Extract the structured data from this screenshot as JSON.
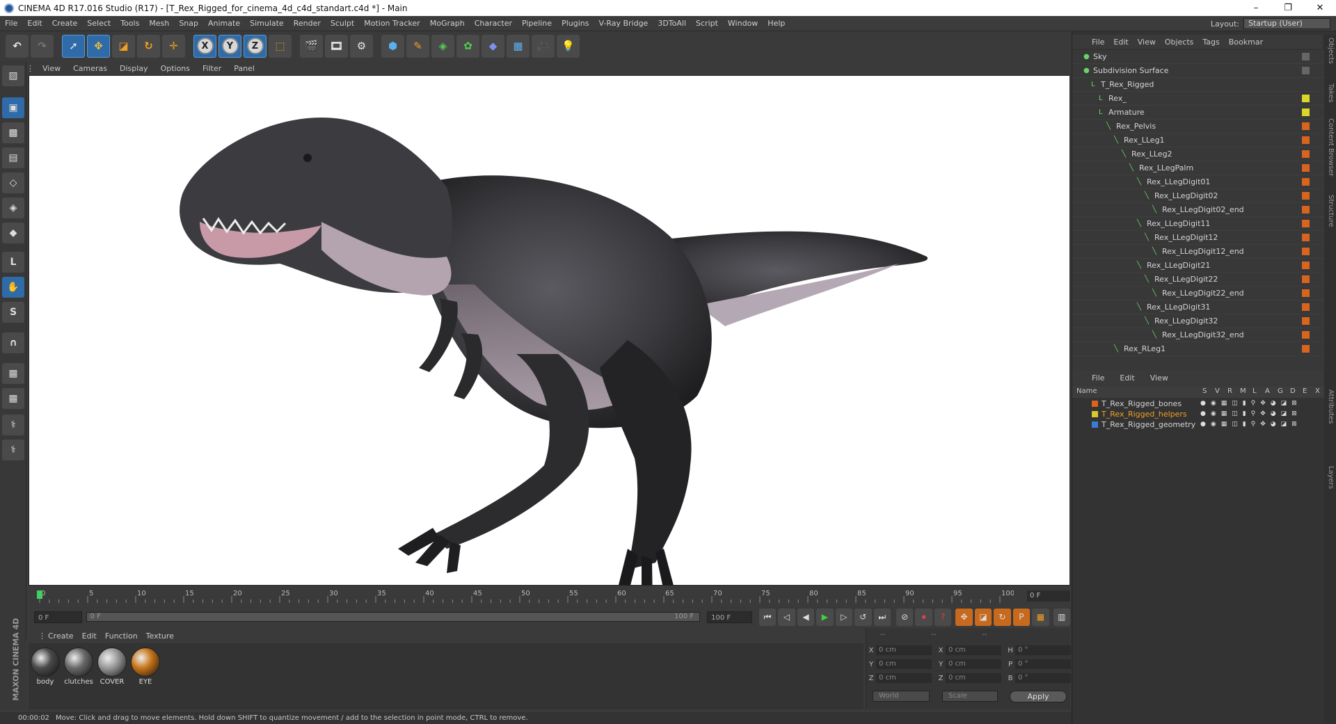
{
  "window": {
    "title": "CINEMA 4D R17.016 Studio (R17) - [T_Rex_Rigged_for_cinema_4d_c4d_standart.c4d *] - Main"
  },
  "menubar": [
    "File",
    "Edit",
    "Create",
    "Select",
    "Tools",
    "Mesh",
    "Snap",
    "Animate",
    "Simulate",
    "Render",
    "Sculpt",
    "Motion Tracker",
    "MoGraph",
    "Character",
    "Pipeline",
    "Plugins",
    "V-Ray Bridge",
    "3DToAll",
    "Script",
    "Window",
    "Help"
  ],
  "layout": {
    "label": "Layout:",
    "value": "Startup (User)"
  },
  "viewport": {
    "menu": [
      "View",
      "Cameras",
      "Display",
      "Options",
      "Filter",
      "Panel"
    ]
  },
  "timeline": {
    "ticks": [
      "0",
      "5",
      "10",
      "15",
      "20",
      "25",
      "30",
      "35",
      "40",
      "45",
      "50",
      "55",
      "60",
      "65",
      "70",
      "75",
      "80",
      "85",
      "90",
      "95",
      "100"
    ],
    "current_frame": "0 F",
    "start_field": "0 F",
    "slider_start": "0 F",
    "slider_end": "100 F",
    "end_field": "100 F"
  },
  "materials": {
    "menu": [
      "Create",
      "Edit",
      "Function",
      "Texture"
    ],
    "items": [
      {
        "name": "body",
        "color": "#4a4a4a"
      },
      {
        "name": "clutches",
        "color": "#6a6a6a"
      },
      {
        "name": "COVER",
        "color": "#9a9a9a"
      },
      {
        "name": "EYE",
        "color": "#c8761a"
      }
    ]
  },
  "coords": {
    "headers": [
      "--",
      "--",
      "--"
    ],
    "rows": [
      {
        "a1": "X",
        "v1": "0 cm",
        "a2": "X",
        "v2": "0 cm",
        "a3": "H",
        "v3": "0 °"
      },
      {
        "a1": "Y",
        "v1": "0 cm",
        "a2": "Y",
        "v2": "0 cm",
        "a3": "P",
        "v3": "0 °"
      },
      {
        "a1": "Z",
        "v1": "0 cm",
        "a2": "Z",
        "v2": "0 cm",
        "a3": "B",
        "v3": "0 °"
      }
    ],
    "world": "World",
    "scale": "Scale",
    "apply": "Apply"
  },
  "status": {
    "time": "00:00:02",
    "message": "Move: Click and drag to move elements. Hold down SHIFT to quantize movement / add to the selection in point mode, CTRL to remove."
  },
  "brand": "MAXON CINEMA 4D",
  "objects": {
    "menu": [
      "File",
      "Edit",
      "View",
      "Objects",
      "Tags",
      "Bookmar"
    ],
    "items": [
      {
        "name": "Sky",
        "depth": 0,
        "tag": "#666666"
      },
      {
        "name": "Subdivision Surface",
        "depth": 0,
        "tag": "#666666"
      },
      {
        "name": "T_Rex_Rigged",
        "depth": 1,
        "tag": ""
      },
      {
        "name": "Rex_",
        "depth": 2,
        "tag": "#d8d82a"
      },
      {
        "name": "Armature",
        "depth": 2,
        "tag": "#d8d82a"
      },
      {
        "name": "Rex_Pelvis",
        "depth": 3,
        "tag": "#d8641e"
      },
      {
        "name": "Rex_LLeg1",
        "depth": 4,
        "tag": "#d8641e"
      },
      {
        "name": "Rex_LLeg2",
        "depth": 5,
        "tag": "#d8641e"
      },
      {
        "name": "Rex_LLegPalm",
        "depth": 6,
        "tag": "#d8641e"
      },
      {
        "name": "Rex_LLegDigit01",
        "depth": 7,
        "tag": "#d8641e"
      },
      {
        "name": "Rex_LLegDigit02",
        "depth": 8,
        "tag": "#d8641e"
      },
      {
        "name": "Rex_LLegDigit02_end",
        "depth": 9,
        "tag": "#d8641e"
      },
      {
        "name": "Rex_LLegDigit11",
        "depth": 7,
        "tag": "#d8641e"
      },
      {
        "name": "Rex_LLegDigit12",
        "depth": 8,
        "tag": "#d8641e"
      },
      {
        "name": "Rex_LLegDigit12_end",
        "depth": 9,
        "tag": "#d8641e"
      },
      {
        "name": "Rex_LLegDigit21",
        "depth": 7,
        "tag": "#d8641e"
      },
      {
        "name": "Rex_LLegDigit22",
        "depth": 8,
        "tag": "#d8641e"
      },
      {
        "name": "Rex_LLegDigit22_end",
        "depth": 9,
        "tag": "#d8641e"
      },
      {
        "name": "Rex_LLegDigit31",
        "depth": 7,
        "tag": "#d8641e"
      },
      {
        "name": "Rex_LLegDigit32",
        "depth": 8,
        "tag": "#d8641e"
      },
      {
        "name": "Rex_LLegDigit32_end",
        "depth": 9,
        "tag": "#d8641e"
      },
      {
        "name": "Rex_RLeg1",
        "depth": 4,
        "tag": "#d8641e"
      }
    ]
  },
  "layers": {
    "menu": [
      "File",
      "Edit",
      "View"
    ],
    "header": {
      "name": "Name",
      "cols": [
        "S",
        "V",
        "R",
        "M",
        "L",
        "A",
        "G",
        "D",
        "E",
        "X"
      ]
    },
    "items": [
      {
        "name": "T_Rex_Rigged_bones",
        "color": "#d8641e",
        "text_color": "#d4d4d4"
      },
      {
        "name": "T_Rex_Rigged_helpers",
        "color": "#d8c82a",
        "text_color": "#f0a020"
      },
      {
        "name": "T_Rex_Rigged_geometry",
        "color": "#3a7ad8",
        "text_color": "#d4d4d4"
      }
    ]
  },
  "side_tabs": [
    "Objects",
    "Takes",
    "Content Browser",
    "Structure",
    "Attributes",
    "Layers"
  ]
}
